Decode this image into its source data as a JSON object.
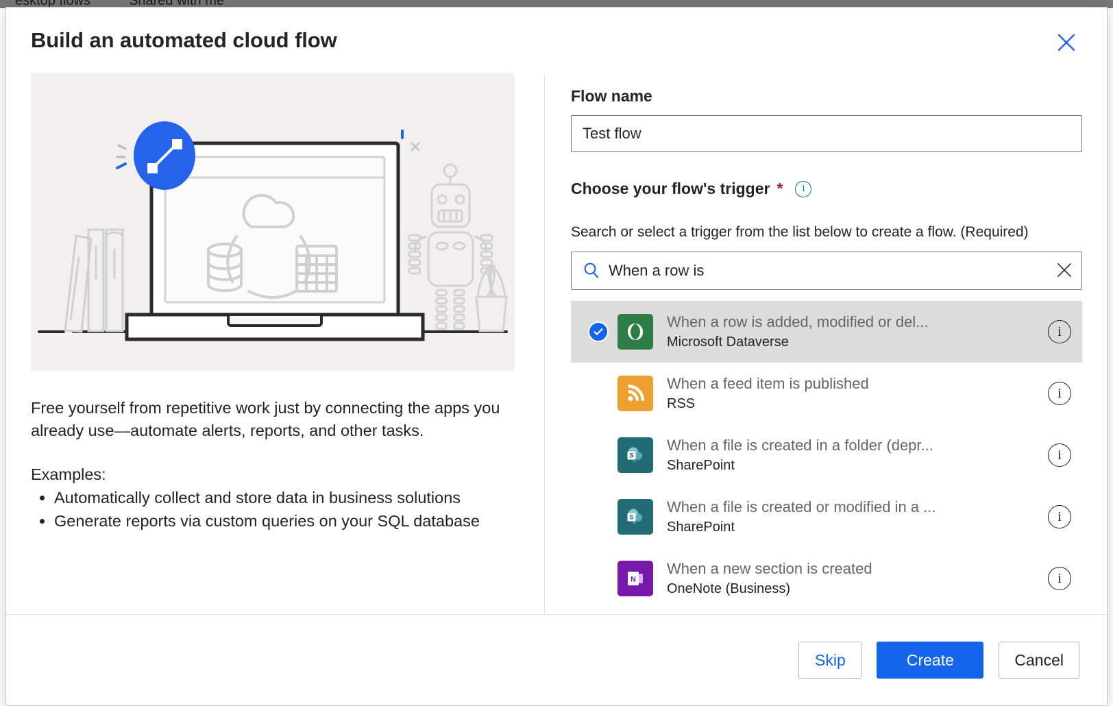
{
  "background": {
    "nav_items": [
      "esktop flows",
      "Shared with me"
    ]
  },
  "dialog": {
    "title": "Build an automated cloud flow",
    "close_label": "Close"
  },
  "left": {
    "lead": "Free yourself from repetitive work just by connecting the apps you already use—automate alerts, reports, and other tasks.",
    "examples_label": "Examples:",
    "examples": [
      "Automatically collect and store data in business solutions",
      "Generate reports via custom queries on your SQL database"
    ],
    "illustration_name": "automated-cloud-flow-illustration"
  },
  "form": {
    "flow_name_label": "Flow name",
    "flow_name_value": "Test flow",
    "flow_name_placeholder": "Flow name",
    "trigger_label": "Choose your flow's trigger",
    "required_mark": "*",
    "info_glyph": "i",
    "helper_text": "Search or select a trigger from the list below to create a flow. (Required)",
    "search_value": "When a row is",
    "search_placeholder": "Search",
    "clear_label": "Clear"
  },
  "triggers": [
    {
      "name": "When a row is added, modified or del...",
      "connector": "Microsoft Dataverse",
      "icon": "dataverse-icon",
      "icon_color": "#2e7d46",
      "selected": true,
      "info_glyph": "i"
    },
    {
      "name": "When a feed item is published",
      "connector": "RSS",
      "icon": "rss-icon",
      "icon_color": "#eda02f",
      "selected": false,
      "info_glyph": "i"
    },
    {
      "name": "When a file is created in a folder (depr...",
      "connector": "SharePoint",
      "icon": "sharepoint-icon",
      "icon_color": "#216b72",
      "selected": false,
      "info_glyph": "i"
    },
    {
      "name": "When a file is created or modified in a ...",
      "connector": "SharePoint",
      "icon": "sharepoint-icon",
      "icon_color": "#216b72",
      "selected": false,
      "info_glyph": "i"
    },
    {
      "name": "When a new section is created",
      "connector": "OneNote (Business)",
      "icon": "onenote-icon",
      "icon_color": "#7719aa",
      "selected": false,
      "info_glyph": "i"
    }
  ],
  "footer": {
    "skip_label": "Skip",
    "create_label": "Create",
    "cancel_label": "Cancel"
  },
  "colors": {
    "accent_blue": "#1565ec",
    "link_blue": "#0f6cbd",
    "required_red": "#a4262c",
    "selected_row": "#dcdcdc",
    "illustration_bg": "#f1f0ef"
  }
}
